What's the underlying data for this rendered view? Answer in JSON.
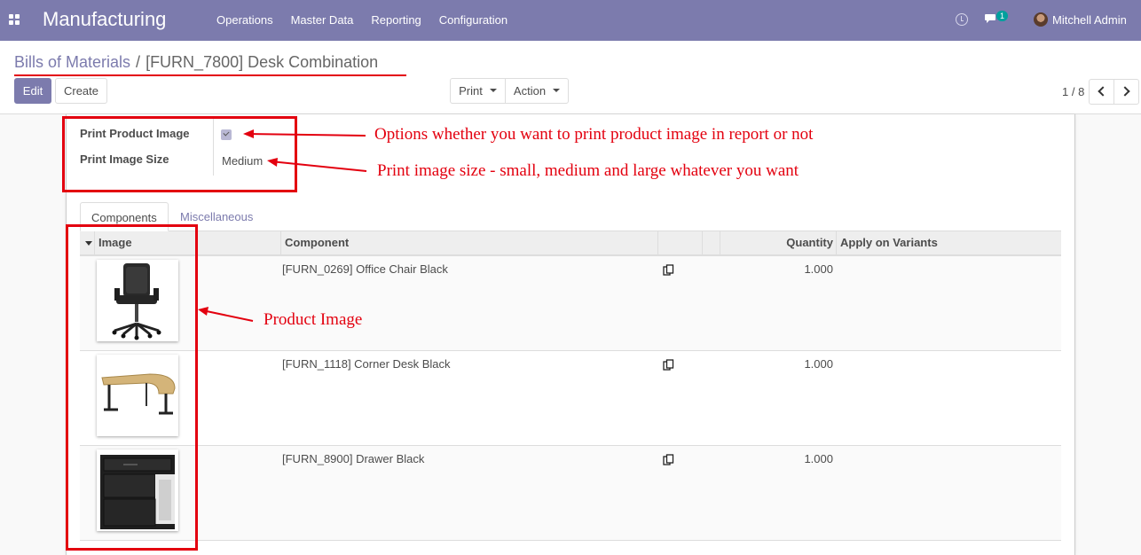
{
  "navbar": {
    "app_name": "Manufacturing",
    "menu": [
      "Operations",
      "Master Data",
      "Reporting",
      "Configuration"
    ],
    "chat_count": "1",
    "user_name": "Mitchell Admin"
  },
  "breadcrumb": {
    "parent": "Bills of Materials",
    "separator": "/",
    "current": "[FURN_7800] Desk Combination"
  },
  "buttons": {
    "edit": "Edit",
    "create": "Create",
    "print": "Print",
    "action": "Action"
  },
  "pager": {
    "value": "1 / 8"
  },
  "form": {
    "print_product_image_label": "Print Product Image",
    "print_product_image_checked": true,
    "print_image_size_label": "Print Image Size",
    "print_image_size_value": "Medium"
  },
  "tabs": [
    "Components",
    "Miscellaneous"
  ],
  "table": {
    "columns": [
      "Image",
      "Component",
      "",
      "",
      "Quantity",
      "Apply on Variants"
    ],
    "rows": [
      {
        "component": "[FURN_0269] Office Chair Black",
        "quantity": "1.000",
        "image": "office-chair"
      },
      {
        "component": "[FURN_1118] Corner Desk Black",
        "quantity": "1.000",
        "image": "corner-desk"
      },
      {
        "component": "[FURN_8900] Drawer Black",
        "quantity": "1.000",
        "image": "drawer"
      }
    ]
  },
  "annotations": {
    "options_note": "Options whether you want to print product image in report or not",
    "size_note": "Print image size - small, medium and large whatever you want",
    "image_note": "Product Image",
    "color": "#e3000f"
  },
  "colors": {
    "brand": "#7c7bad",
    "badge": "#00a09d"
  }
}
